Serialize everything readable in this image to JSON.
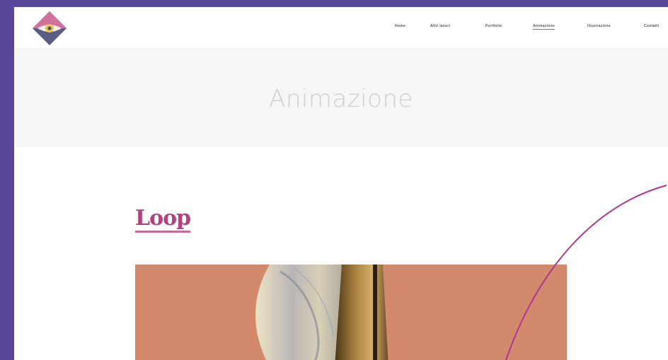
{
  "colors": {
    "frame": "#5a4699",
    "accent": "#b0427f",
    "title_band": "#f6f6f6",
    "thumbnail_bg": "#d38a6c",
    "arc": "#b0368f"
  },
  "header": {
    "logo_icon": "diamond-eye-logo",
    "nav": [
      {
        "label": "Home"
      },
      {
        "label": "Altri lavori"
      },
      {
        "label": "Portfolio"
      },
      {
        "label": "Animazione",
        "active": true
      },
      {
        "label": "Illustrazione"
      },
      {
        "label": "Contatti"
      }
    ]
  },
  "page": {
    "title": "Animazione"
  },
  "section": {
    "title": "Loop"
  },
  "thumbnail": {
    "icon": "abstract-animation-still"
  }
}
